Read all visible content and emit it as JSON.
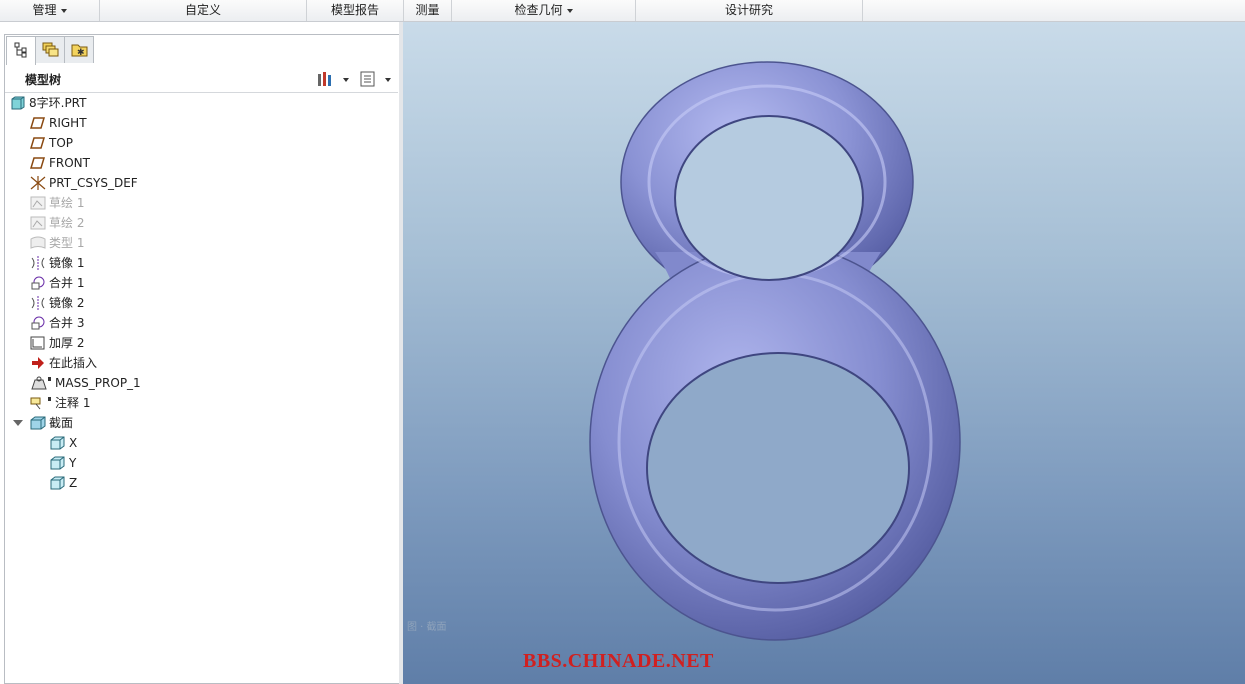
{
  "ribbon": {
    "groups": [
      {
        "label": "管理",
        "dropdown": true
      },
      {
        "label": "自定义",
        "dropdown": false
      },
      {
        "label": "模型报告",
        "dropdown": false
      },
      {
        "label": "测量",
        "dropdown": false
      },
      {
        "label": "检查几何",
        "dropdown": true
      },
      {
        "label": "设计研究",
        "dropdown": false
      }
    ]
  },
  "panel": {
    "tabs": [
      "model-tree-tab",
      "layers-tab",
      "favorites-tab"
    ],
    "title": "模型树"
  },
  "tree": {
    "root": "8字环.PRT",
    "items": [
      {
        "label": "RIGHT",
        "icon": "datum-plane-icon",
        "dim": false
      },
      {
        "label": "TOP",
        "icon": "datum-plane-icon",
        "dim": false
      },
      {
        "label": "FRONT",
        "icon": "datum-plane-icon",
        "dim": false
      },
      {
        "label": "PRT_CSYS_DEF",
        "icon": "csys-icon",
        "dim": false
      },
      {
        "label": "草绘 1",
        "icon": "sketch-icon",
        "dim": true
      },
      {
        "label": "草绘 2",
        "icon": "sketch-icon",
        "dim": true
      },
      {
        "label": "类型 1",
        "icon": "style-icon",
        "dim": true
      },
      {
        "label": "镜像 1",
        "icon": "mirror-icon",
        "dim": false
      },
      {
        "label": "合并 1",
        "icon": "merge-icon",
        "dim": false
      },
      {
        "label": "镜像 2",
        "icon": "mirror-icon",
        "dim": false
      },
      {
        "label": "合并 3",
        "icon": "merge-icon",
        "dim": false
      },
      {
        "label": "加厚 2",
        "icon": "thicken-icon",
        "dim": false
      },
      {
        "label": "在此插入",
        "icon": "insert-here-icon",
        "dim": false
      },
      {
        "label": "MASS_PROP_1",
        "icon": "mass-prop-icon",
        "dim": false
      },
      {
        "label": "注释 1",
        "icon": "annotation-icon",
        "dim": false
      }
    ],
    "sections": {
      "label": "截面",
      "children": [
        "X",
        "Y",
        "Z"
      ]
    }
  },
  "viewport": {
    "watermark": "BBS.CHINADE.NET",
    "faint_label": "图 · 截面",
    "model_color": "#8a92d4"
  }
}
